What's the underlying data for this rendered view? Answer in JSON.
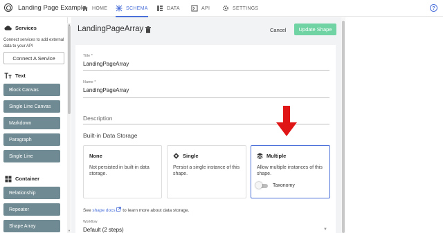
{
  "app": {
    "title": "Landing Page Example"
  },
  "nav": {
    "tabs": [
      {
        "label": "HOME",
        "icon": "home-icon"
      },
      {
        "label": "SCHEMA",
        "icon": "schema-icon",
        "active": true
      },
      {
        "label": "DATA",
        "icon": "data-icon"
      },
      {
        "label": "API",
        "icon": "api-icon"
      },
      {
        "label": "SETTINGS",
        "icon": "gear-icon"
      }
    ],
    "help": "?"
  },
  "sidebar": {
    "services": {
      "heading": "Services",
      "description": "Connect services to add external data to your API",
      "button": "Connect A Service"
    },
    "text_section": {
      "heading": "Text",
      "items": [
        "Block Canvas",
        "Single Line Canvas",
        "Markdown",
        "Paragraph",
        "Single Line"
      ]
    },
    "container_section": {
      "heading": "Container",
      "items": [
        "Relationship",
        "Repeater",
        "Shape Array"
      ]
    }
  },
  "main": {
    "title": "LandingPageArray",
    "cancel": "Cancel",
    "update": "Update Shape",
    "fields": {
      "title": {
        "label": "Title *",
        "value": "LandingPageArray"
      },
      "name": {
        "label": "Name *",
        "value": "LandingPageArray"
      },
      "description": {
        "placeholder": "Description"
      }
    },
    "storage": {
      "heading": "Built-in Data Storage",
      "options": [
        {
          "title": "None",
          "description": "Not persisted in built-in data storage."
        },
        {
          "title": "Single",
          "description": "Persist a single instance of this shape."
        },
        {
          "title": "Multiple",
          "description": "Allow multiple instances of this shape.",
          "selected": true,
          "toggle_label": "Taxonomy",
          "toggle_on": false
        }
      ]
    },
    "docs": {
      "prefix": "See",
      "link": "shape docs",
      "suffix": "to learn more about data storage."
    },
    "workflow": {
      "label": "Workflow",
      "value": "Default (2 steps)"
    }
  },
  "colors": {
    "accent": "#4a6fd9",
    "sidebar_item": "#6f8a92",
    "update_button": "#6fd3a3",
    "arrow": "#e01616"
  }
}
